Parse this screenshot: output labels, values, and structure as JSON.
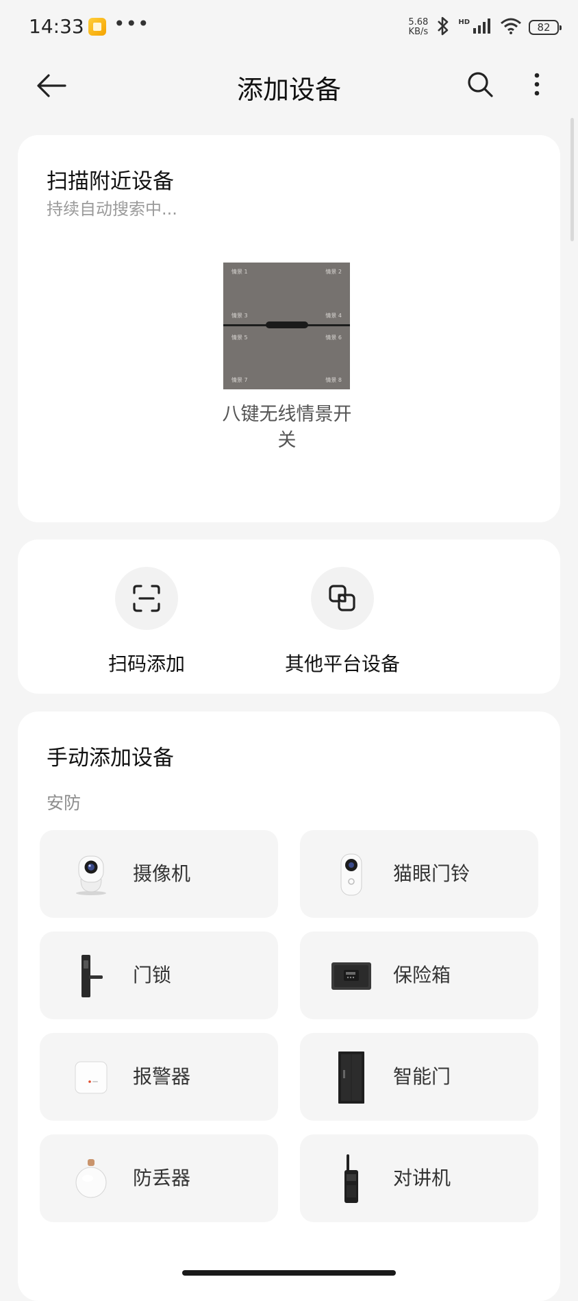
{
  "status_bar": {
    "time": "14:33",
    "more_dots": "•••",
    "net_speed_value": "5.68",
    "net_speed_unit": "KB/s",
    "hd_label": "HD",
    "battery": "82"
  },
  "header": {
    "title": "添加设备"
  },
  "scan_section": {
    "title": "扫描附近设备",
    "subtitle": "持续自动搜索中...",
    "device": {
      "name": "八键无线情景开关",
      "icon": "eight-key-switch-image",
      "key_labels": [
        "情景 1",
        "情景 2",
        "情景 3",
        "情景 4",
        "情景 5",
        "情景 6",
        "情景 7",
        "情景 8"
      ]
    }
  },
  "quick_actions": [
    {
      "label": "扫码添加",
      "icon": "scan-code-icon"
    },
    {
      "label": "其他平台设备",
      "icon": "other-platform-icon"
    }
  ],
  "manual_section": {
    "title": "手动添加设备",
    "category": "安防",
    "items": [
      {
        "label": "摄像机",
        "icon": "camera-icon"
      },
      {
        "label": "猫眼门铃",
        "icon": "peephole-doorbell-icon"
      },
      {
        "label": "门锁",
        "icon": "door-lock-icon"
      },
      {
        "label": "保险箱",
        "icon": "safe-box-icon"
      },
      {
        "label": "报警器",
        "icon": "alarm-icon"
      },
      {
        "label": "智能门",
        "icon": "smart-door-icon"
      },
      {
        "label": "防丢器",
        "icon": "anti-lost-tracker-icon"
      },
      {
        "label": "对讲机",
        "icon": "walkie-talkie-icon"
      }
    ]
  },
  "colors": {
    "background": "#f5f5f5",
    "card": "#ffffff",
    "tile": "#f5f5f5",
    "secondary_text": "#9a9a9a"
  }
}
